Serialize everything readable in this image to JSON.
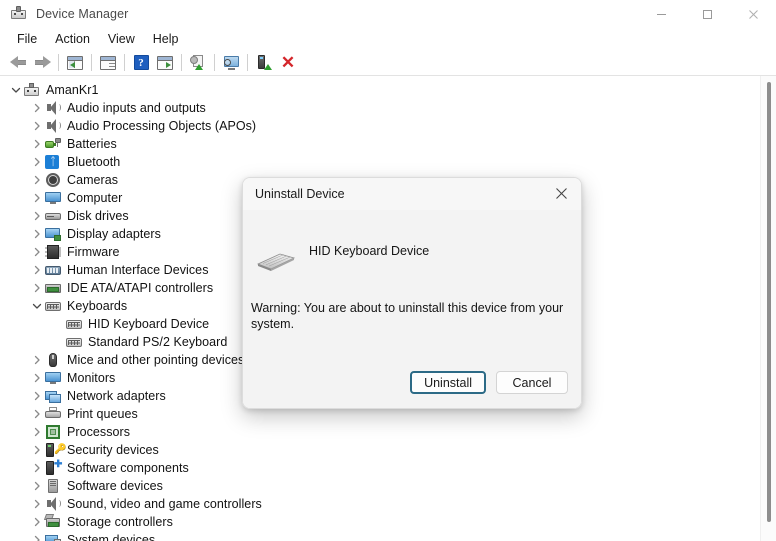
{
  "window": {
    "title": "Device Manager",
    "icon": "device-manager-icon",
    "controls": {
      "minimize": "—",
      "maximize": "□",
      "close": "✕"
    }
  },
  "menubar": {
    "items": [
      {
        "label": "File",
        "name": "menu-file"
      },
      {
        "label": "Action",
        "name": "menu-action"
      },
      {
        "label": "View",
        "name": "menu-view"
      },
      {
        "label": "Help",
        "name": "menu-help"
      }
    ]
  },
  "toolbar": {
    "buttons": [
      {
        "name": "back-button",
        "icon": "back-arrow-icon",
        "title": "Back"
      },
      {
        "name": "forward-button",
        "icon": "forward-arrow-icon",
        "title": "Forward"
      },
      {
        "name": "show-hide-console-tree-button",
        "icon": "console-tree-icon",
        "title": "Show/Hide Console Tree"
      },
      {
        "name": "properties-button",
        "icon": "properties-icon",
        "title": "Properties"
      },
      {
        "name": "help-button",
        "icon": "help-icon",
        "title": "Help"
      },
      {
        "name": "show-hide-action-pane-button",
        "icon": "action-pane-icon",
        "title": "Show/Hide Action Pane"
      },
      {
        "name": "update-driver-button",
        "icon": "update-driver-icon",
        "title": "Update Driver"
      },
      {
        "name": "scan-hardware-changes-button",
        "icon": "scan-hardware-icon",
        "title": "Scan for hardware changes"
      },
      {
        "name": "enable-device-button",
        "icon": "enable-device-icon",
        "title": "Enable device"
      },
      {
        "name": "uninstall-device-button",
        "icon": "uninstall-x-icon",
        "title": "Uninstall device"
      }
    ]
  },
  "tree": {
    "nodes": [
      {
        "label": "AmanKr1",
        "icon": "computer-root-icon",
        "indent": 0,
        "expander": "expanded",
        "name": "tree-node-amankr1"
      },
      {
        "label": "Audio inputs and outputs",
        "icon": "speaker-icon",
        "indent": 1,
        "expander": "collapsed",
        "name": "tree-node-audio-inputs-and-outputs"
      },
      {
        "label": "Audio Processing Objects (APOs)",
        "icon": "speaker-icon",
        "indent": 1,
        "expander": "collapsed",
        "name": "tree-node-audio-processing-objects"
      },
      {
        "label": "Batteries",
        "icon": "battery-icon",
        "indent": 1,
        "expander": "collapsed",
        "name": "tree-node-batteries"
      },
      {
        "label": "Bluetooth",
        "icon": "bluetooth-icon",
        "indent": 1,
        "expander": "collapsed",
        "name": "tree-node-bluetooth"
      },
      {
        "label": "Cameras",
        "icon": "camera-icon",
        "indent": 1,
        "expander": "collapsed",
        "name": "tree-node-cameras"
      },
      {
        "label": "Computer",
        "icon": "monitor-icon",
        "indent": 1,
        "expander": "collapsed",
        "name": "tree-node-computer"
      },
      {
        "label": "Disk drives",
        "icon": "disk-drive-icon",
        "indent": 1,
        "expander": "collapsed",
        "name": "tree-node-disk-drives"
      },
      {
        "label": "Display adapters",
        "icon": "display-adapter-icon",
        "indent": 1,
        "expander": "collapsed",
        "name": "tree-node-display-adapters"
      },
      {
        "label": "Firmware",
        "icon": "firmware-chip-icon",
        "indent": 1,
        "expander": "collapsed",
        "name": "tree-node-firmware"
      },
      {
        "label": "Human Interface Devices",
        "icon": "hid-icon",
        "indent": 1,
        "expander": "collapsed",
        "name": "tree-node-human-interface-devices"
      },
      {
        "label": "IDE ATA/ATAPI controllers",
        "icon": "ide-controller-icon",
        "indent": 1,
        "expander": "collapsed",
        "name": "tree-node-ide-ata-atapi-controllers"
      },
      {
        "label": "Keyboards",
        "icon": "keyboard-icon",
        "indent": 1,
        "expander": "expanded",
        "name": "tree-node-keyboards"
      },
      {
        "label": "HID Keyboard Device",
        "icon": "keyboard-icon",
        "indent": 2,
        "expander": "none",
        "name": "tree-node-hid-keyboard-device"
      },
      {
        "label": "Standard PS/2 Keyboard",
        "icon": "keyboard-icon",
        "indent": 2,
        "expander": "none",
        "name": "tree-node-standard-ps2-keyboard"
      },
      {
        "label": "Mice and other pointing devices",
        "icon": "mouse-icon",
        "indent": 1,
        "expander": "collapsed",
        "name": "tree-node-mice-and-other-pointing-devices"
      },
      {
        "label": "Monitors",
        "icon": "monitor-icon",
        "indent": 1,
        "expander": "collapsed",
        "name": "tree-node-monitors"
      },
      {
        "label": "Network adapters",
        "icon": "network-adapter-icon",
        "indent": 1,
        "expander": "collapsed",
        "name": "tree-node-network-adapters"
      },
      {
        "label": "Print queues",
        "icon": "printer-icon",
        "indent": 1,
        "expander": "collapsed",
        "name": "tree-node-print-queues"
      },
      {
        "label": "Processors",
        "icon": "processor-icon",
        "indent": 1,
        "expander": "collapsed",
        "name": "tree-node-processors"
      },
      {
        "label": "Security devices",
        "icon": "security-device-icon",
        "indent": 1,
        "expander": "collapsed",
        "name": "tree-node-security-devices"
      },
      {
        "label": "Software components",
        "icon": "software-component-icon",
        "indent": 1,
        "expander": "collapsed",
        "name": "tree-node-software-components"
      },
      {
        "label": "Software devices",
        "icon": "software-device-icon",
        "indent": 1,
        "expander": "collapsed",
        "name": "tree-node-software-devices"
      },
      {
        "label": "Sound, video and game controllers",
        "icon": "speaker-icon",
        "indent": 1,
        "expander": "collapsed",
        "name": "tree-node-sound-video-and-game-controllers"
      },
      {
        "label": "Storage controllers",
        "icon": "storage-controller-icon",
        "indent": 1,
        "expander": "collapsed",
        "name": "tree-node-storage-controllers"
      },
      {
        "label": "System devices",
        "icon": "system-device-icon",
        "indent": 1,
        "expander": "collapsed",
        "name": "tree-node-system-devices"
      }
    ]
  },
  "dialog": {
    "title": "Uninstall Device",
    "close_glyph": "✕",
    "device_name": "HID Keyboard Device",
    "device_icon": "keyboard-3d-icon",
    "warning": "Warning: You are about to uninstall this device from your system.",
    "buttons": {
      "confirm": "Uninstall",
      "cancel": "Cancel"
    }
  },
  "colors": {
    "accent_focus": "#2c6a86",
    "uninstall_x": "#d4262b",
    "help_blue": "#1f5fbf",
    "bluetooth_blue": "#1c7fd6",
    "dialog_bg": "#f3f3f3",
    "window_bg": "#ffffff"
  }
}
